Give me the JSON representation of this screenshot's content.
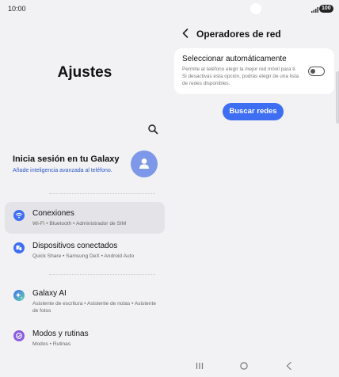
{
  "status": {
    "time": "10:00",
    "battery": "100"
  },
  "left": {
    "title": "Ajustes",
    "signin": {
      "title": "Inicia sesión en tu Galaxy",
      "subtitle": "Añade inteligencia avanzada al teléfono."
    },
    "items": [
      {
        "label": "Conexiones",
        "sub": "Wi-Fi  •  Bluetooth  •  Administrador de SIM",
        "icon": "wifi-icon",
        "color": "#3e6ef2"
      },
      {
        "label": "Dispositivos conectados",
        "sub": "Quick Share  •  Samsung DeX  •  Android Auto",
        "icon": "devices-icon",
        "color": "#3e6ef2"
      },
      {
        "label": "Galaxy AI",
        "sub": "Asistente de escritura  •  Asistente de notas  •  Asistente de fotos",
        "icon": "galaxy-ai-icon",
        "color": "#4a6fe0"
      },
      {
        "label": "Modos y rutinas",
        "sub": "Modos  •  Rutinas",
        "icon": "modes-icon",
        "color": "#8b5ce0"
      }
    ]
  },
  "right": {
    "title": "Operadores de red",
    "auto_select": {
      "title": "Seleccionar automáticamente",
      "description": "Permite al teléfono elegir la mejor red móvil para ti. Si desactivas esta opción, podrás elegir de una lista de redes disponibles.",
      "enabled": false
    },
    "search_button": "Buscar redes"
  },
  "colors": {
    "accent": "#3e6ef2",
    "avatar": "#7d98e8",
    "background": "#f2f2f4"
  }
}
